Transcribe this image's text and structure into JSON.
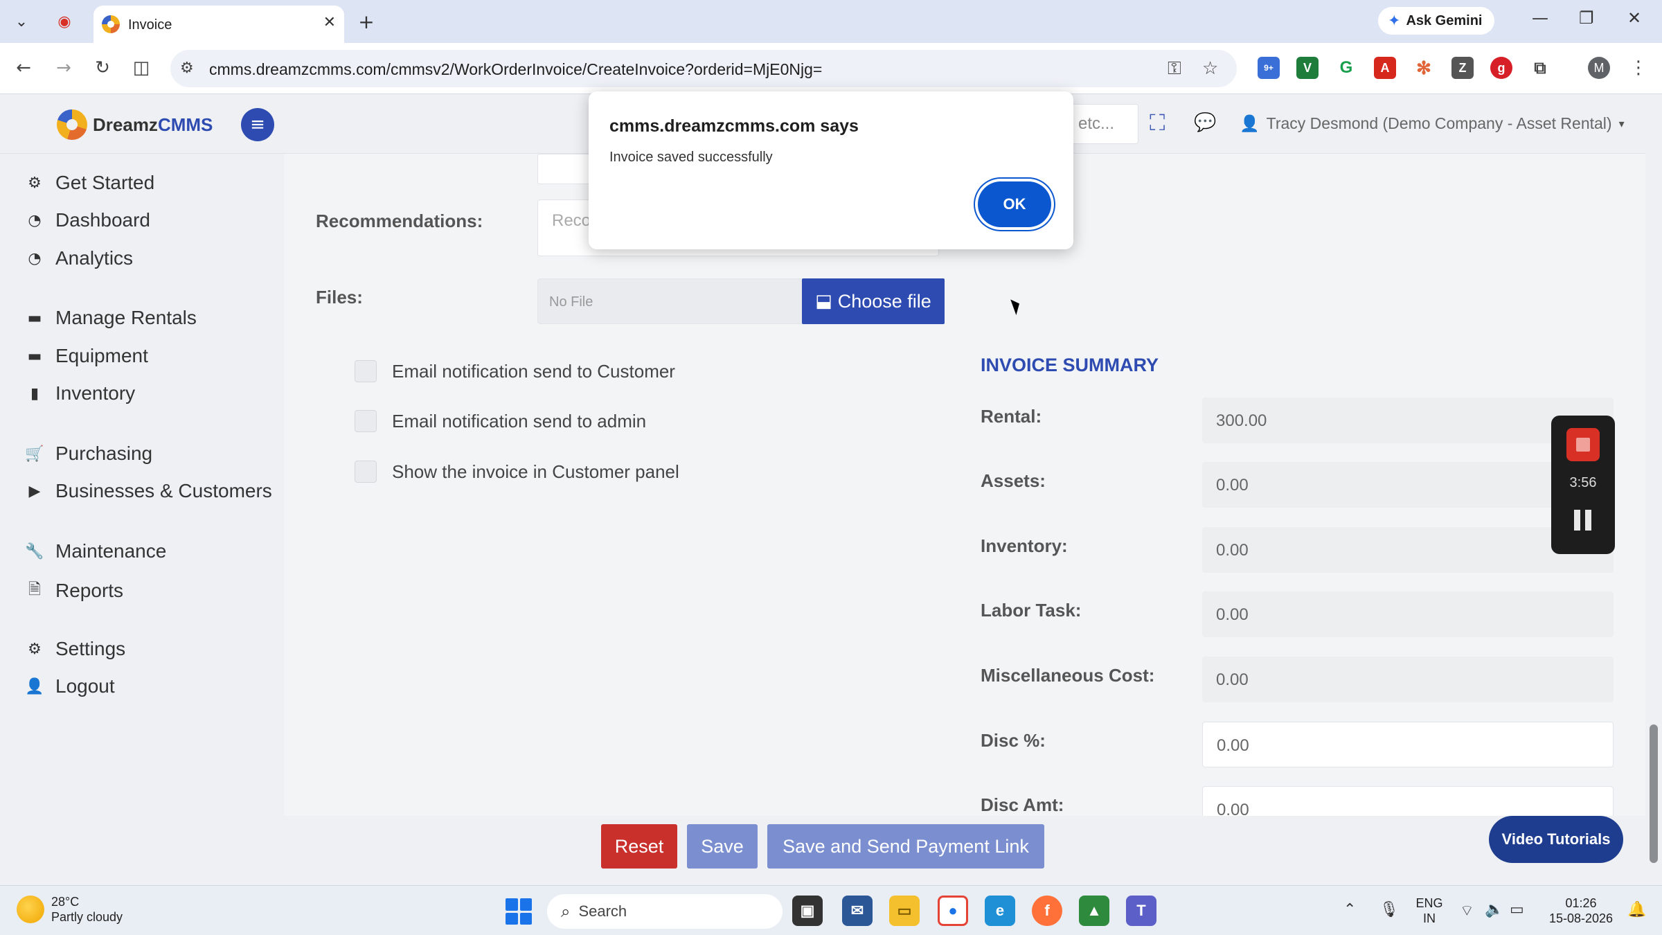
{
  "browser": {
    "tab_title": "Invoice",
    "url": "cmms.dreamzcmms.com/cmmsv2/WorkOrderInvoice/CreateInvoice?orderid=MjE0Njg=",
    "ask_gemini": "Ask Gemini",
    "profile_initial": "M",
    "extension_badge": "9+"
  },
  "app": {
    "brand_prefix": "Dreamz",
    "brand_suffix": "CMMS",
    "search_hint": "etc...",
    "user": "Tracy Desmond (Demo Company - Asset Rental)"
  },
  "sidebar": {
    "items": [
      {
        "label": "Get Started",
        "icon": "gears-icon"
      },
      {
        "label": "Dashboard",
        "icon": "gauge-icon"
      },
      {
        "label": "Analytics",
        "icon": "gauge-icon"
      },
      {
        "label": "Manage Rentals",
        "icon": "rental-icon"
      },
      {
        "label": "Equipment",
        "icon": "equipment-icon"
      },
      {
        "label": "Inventory",
        "icon": "inventory-icon"
      },
      {
        "label": "Purchasing",
        "icon": "cart-icon"
      },
      {
        "label": "Businesses & Customers",
        "icon": "video-icon"
      },
      {
        "label": "Maintenance",
        "icon": "wrench-icon"
      },
      {
        "label": "Reports",
        "icon": "file-icon"
      },
      {
        "label": "Settings",
        "icon": "gear-icon"
      },
      {
        "label": "Logout",
        "icon": "user-icon"
      }
    ]
  },
  "form": {
    "recommendations_label": "Recommendations:",
    "recommendations_placeholder": "Reco",
    "files_label": "Files:",
    "no_file": "No File",
    "choose_file": "Choose file",
    "checkboxes": [
      "Email notification send to Customer",
      "Email notification send to admin",
      "Show the invoice in Customer panel"
    ]
  },
  "summary": {
    "title": "INVOICE SUMMARY",
    "rows": [
      {
        "label": "Rental:",
        "value": "300.00"
      },
      {
        "label": "Assets:",
        "value": "0.00"
      },
      {
        "label": "Inventory:",
        "value": "0.00"
      },
      {
        "label": "Labor Task:",
        "value": "0.00"
      },
      {
        "label": "Miscellaneous Cost:",
        "value": "0.00"
      },
      {
        "label": "Disc %:",
        "value": "0.00"
      },
      {
        "label": "Disc Amt:",
        "value": "0.00"
      }
    ]
  },
  "actions": {
    "reset": "Reset",
    "save": "Save",
    "save_send": "Save and Send Payment Link",
    "video_tutorials": "Video Tutorials"
  },
  "recorder": {
    "timer": "3:56"
  },
  "dialog": {
    "title": "cmms.dreamzcmms.com says",
    "message": "Invoice saved successfully",
    "ok": "OK"
  },
  "taskbar": {
    "temperature": "28°C",
    "weather": "Partly cloudy",
    "search": "Search",
    "lang_top": "ENG",
    "lang_bottom": "IN",
    "time": "01:26",
    "date": "15-08-2026"
  },
  "colors": {
    "primary": "#2d4bb0",
    "reset": "#c9302c",
    "dialog_ok": "#0b57d0"
  }
}
